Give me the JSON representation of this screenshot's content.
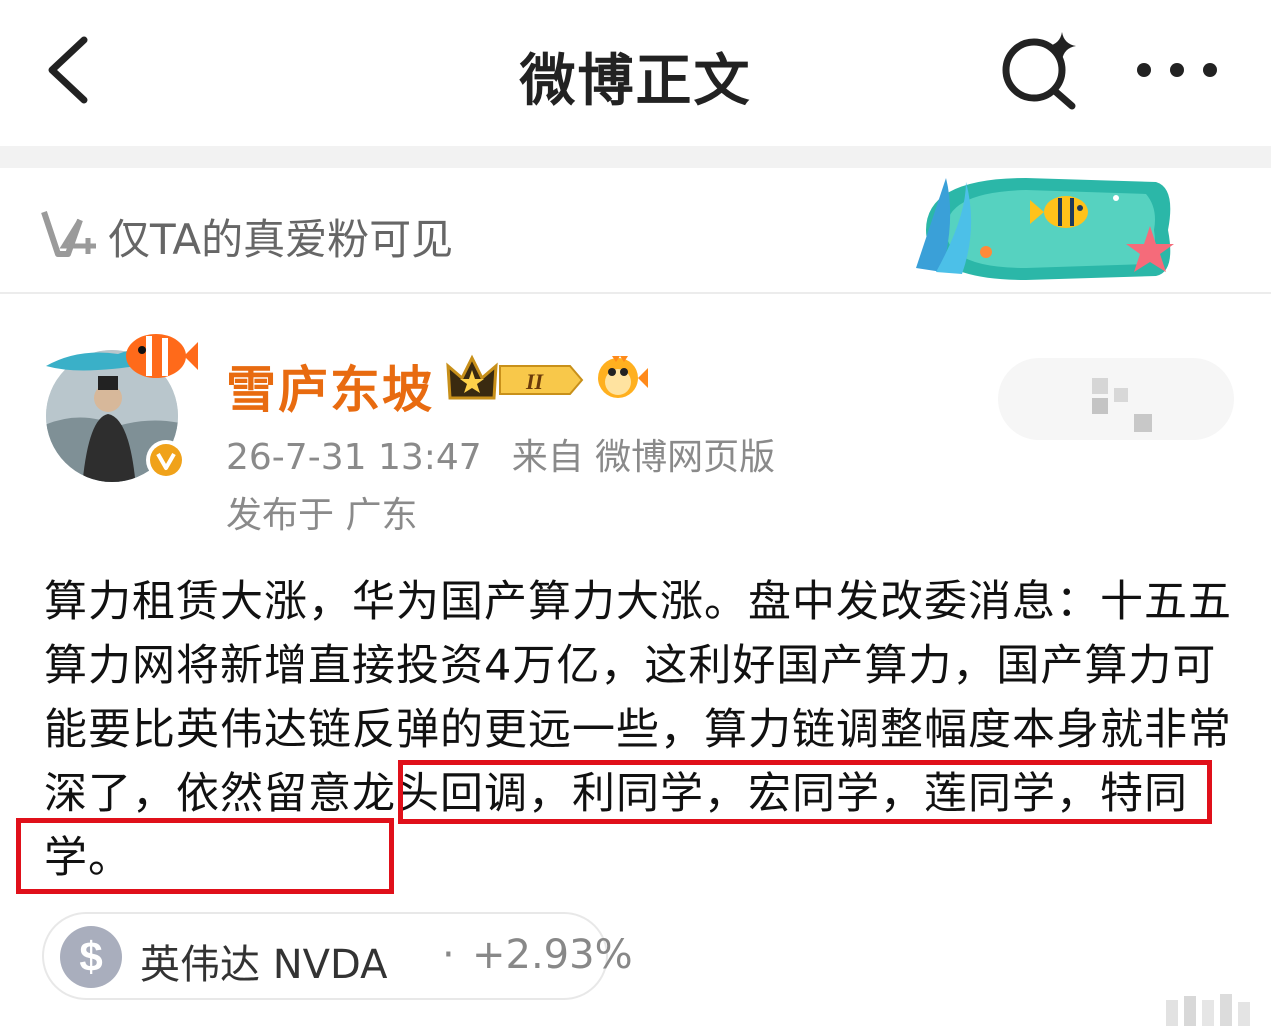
{
  "header": {
    "title": "微博正文",
    "back_icon": "chevron-left-icon",
    "search_icon": "sparkle-search-icon",
    "more_icon": "more-dots-icon"
  },
  "visibility_banner": {
    "icon": "vip-plus-icon",
    "text": "仅TA的真爱粉可见"
  },
  "post": {
    "author": {
      "name": "雪庐东坡",
      "name_color": "#e86b10",
      "verified_badge_text": "V",
      "crown_level": "II"
    },
    "timestamp": "26-7-31 13:47",
    "source": "来自 微博网页版",
    "location": "发布于 广东",
    "body_plain": "算力租赁大涨，华为国产算力大涨。盘中发改委消息：十五五算力网将新增直接投资4万亿，这利好国产算力，国产算力可能要比英伟达链反弹的更远一些，算力链调整幅度本身就非常深了，",
    "body_highlight_1": "依然留意龙头回调，利同学，宏同学，",
    "body_highlight_2": "莲同学，特同学。",
    "highlight_color": "#e0101a"
  },
  "stock_chip": {
    "icon_symbol": "$",
    "name": "英伟达 NVDA",
    "separator": "·",
    "change": "+2.93%"
  }
}
